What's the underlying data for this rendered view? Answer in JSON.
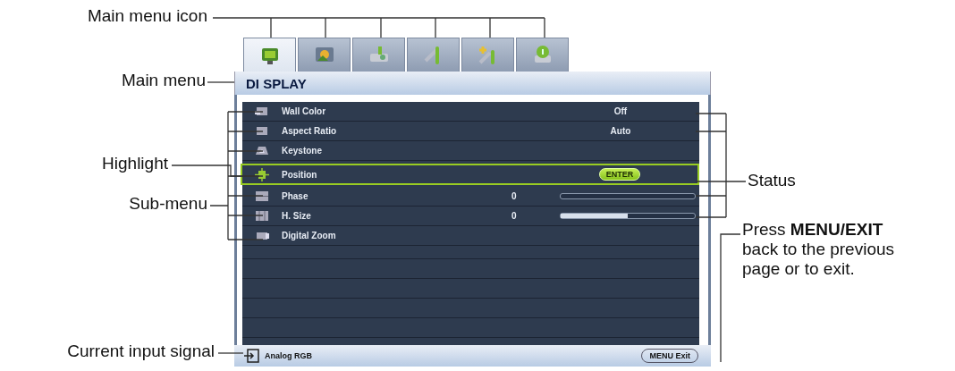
{
  "left_callouts": [
    "Main menu icon",
    "Main menu",
    "Highlight",
    "Sub-menu",
    "Current input signal"
  ],
  "right_callouts": [
    "Status",
    "Press **MENU/EXIT** back to the previous page or to exit."
  ],
  "tabs": [
    {
      "kind": "display",
      "selected": true
    },
    {
      "kind": "picture",
      "selected": false
    },
    {
      "kind": "source",
      "selected": false
    },
    {
      "kind": "setup",
      "selected": false
    },
    {
      "kind": "advanced",
      "selected": false
    },
    {
      "kind": "info",
      "selected": false
    }
  ],
  "menu_title": "DI SPLAY",
  "rows": [
    {
      "label": "Wall Color",
      "kind": "text",
      "status": "Off",
      "selected": false
    },
    {
      "label": "Aspect Ratio",
      "kind": "text",
      "status": "Auto",
      "selected": false
    },
    {
      "label": "Keystone",
      "kind": "none",
      "selected": false
    },
    {
      "label": "Position",
      "kind": "enter",
      "status": "ENTER",
      "selected": true
    },
    {
      "label": "Phase",
      "kind": "slider",
      "value": "0",
      "selected": false
    },
    {
      "label": "H. Size",
      "kind": "slider",
      "value": "0",
      "level": 0.5,
      "selected": false
    },
    {
      "label": "Digital Zoom",
      "kind": "none",
      "selected": false
    }
  ],
  "status_bar": {
    "input": "Analog RGB",
    "exit": "MENU Exit"
  }
}
